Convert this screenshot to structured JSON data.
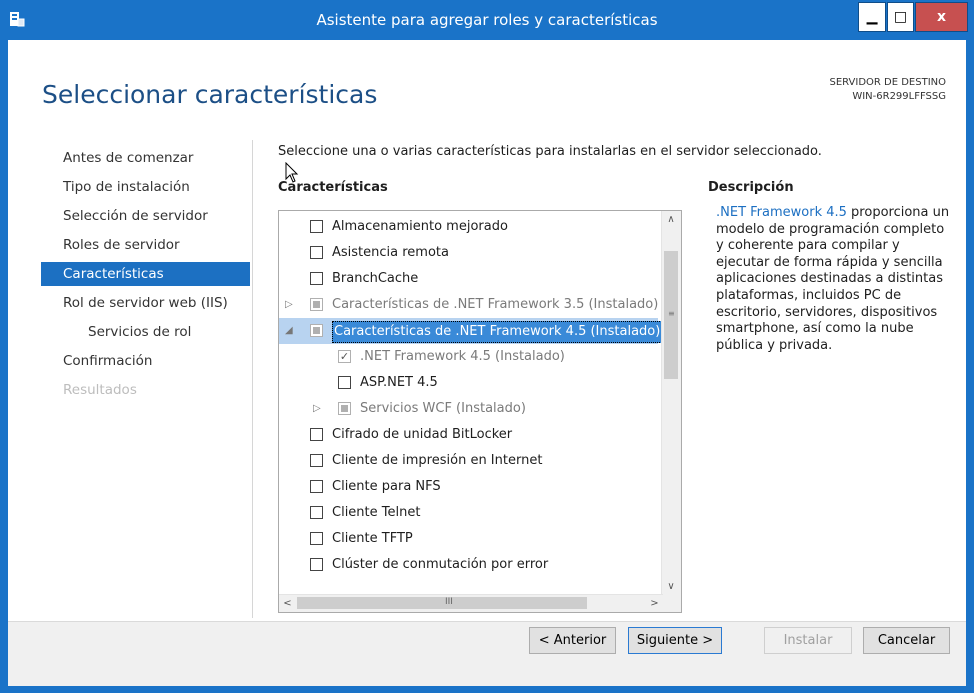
{
  "window": {
    "title": "Asistente para agregar roles y características",
    "controls": {
      "minimize": "▁",
      "maximize": "□",
      "close": "x"
    }
  },
  "page_title": "Seleccionar características",
  "server": {
    "label": "SERVIDOR DE DESTINO",
    "name": "WIN-6R299LFFSSG"
  },
  "nav": [
    {
      "label": "Antes de comenzar",
      "state": "normal"
    },
    {
      "label": "Tipo de instalación",
      "state": "normal"
    },
    {
      "label": "Selección de servidor",
      "state": "normal"
    },
    {
      "label": "Roles de servidor",
      "state": "normal"
    },
    {
      "label": "Características",
      "state": "active"
    },
    {
      "label": "Rol de servidor web (IIS)",
      "state": "normal"
    },
    {
      "label": "Servicios de rol",
      "state": "sub"
    },
    {
      "label": "Confirmación",
      "state": "normal"
    },
    {
      "label": "Resultados",
      "state": "disabled"
    }
  ],
  "instructions": "Seleccione una o varias características para instalarlas en el servidor seleccionado.",
  "features_header": "Características",
  "description_header": "Descripción",
  "features": [
    {
      "label": "Almacenamiento mejorado",
      "level": 0,
      "check": "empty",
      "expander": ""
    },
    {
      "label": "Asistencia remota",
      "level": 0,
      "check": "empty",
      "expander": ""
    },
    {
      "label": "BranchCache",
      "level": 0,
      "check": "empty",
      "expander": ""
    },
    {
      "label": "Características de .NET Framework 3.5 (Instalado)",
      "level": 0,
      "check": "partial",
      "expander": "▷"
    },
    {
      "label": "Características de .NET Framework 4.5 (Instalado)",
      "level": 0,
      "check": "partial",
      "expander": "◢"
    },
    {
      "label": ".NET Framework 4.5 (Instalado)",
      "level": 1,
      "check": "checked",
      "expander": ""
    },
    {
      "label": "ASP.NET 4.5",
      "level": 1,
      "check": "empty",
      "expander": ""
    },
    {
      "label": "Servicios WCF (Instalado)",
      "level": 1,
      "check": "partial",
      "expander": "▷"
    },
    {
      "label": "Cifrado de unidad BitLocker",
      "level": 0,
      "check": "empty",
      "expander": ""
    },
    {
      "label": "Cliente de impresión en Internet",
      "level": 0,
      "check": "empty",
      "expander": ""
    },
    {
      "label": "Cliente para NFS",
      "level": 0,
      "check": "empty",
      "expander": ""
    },
    {
      "label": "Cliente Telnet",
      "level": 0,
      "check": "empty",
      "expander": ""
    },
    {
      "label": "Cliente TFTP",
      "level": 0,
      "check": "empty",
      "expander": ""
    },
    {
      "label": "Clúster de conmutación por error",
      "level": 0,
      "check": "empty",
      "expander": ""
    }
  ],
  "selected_feature_index": 4,
  "description": {
    "link": ".NET Framework 4.5",
    "text": " proporciona un modelo de programación completo y coherente para compilar y ejecutar de forma rápida y sencilla aplicaciones destinadas a distintas plataformas, incluidos PC de escritorio, servidores, dispositivos smartphone, así como la nube pública y privada."
  },
  "scroll": {
    "up": "∧",
    "down": "∨",
    "left": "<",
    "right": ">",
    "vgrip": "≡",
    "hgrip": "III"
  },
  "buttons": {
    "previous": "< Anterior",
    "next": "Siguiente >",
    "install": "Instalar",
    "cancel": "Cancelar"
  },
  "colors": {
    "titlebar": "#1a73c8",
    "accent": "#1c70c2",
    "page_title": "#1c4f86",
    "selection": "#3a8ad8"
  }
}
